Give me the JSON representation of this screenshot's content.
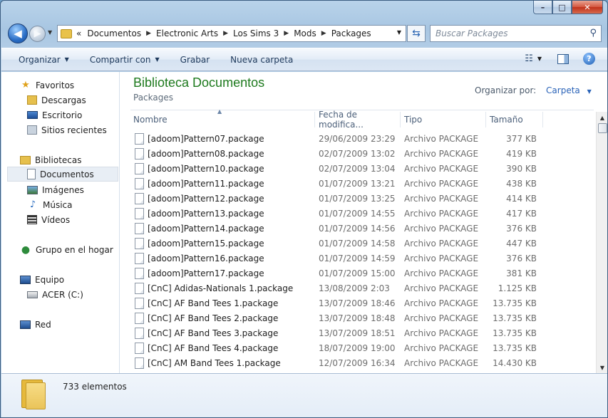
{
  "window": {
    "min_label": "–",
    "max_label": "□",
    "close_label": "✕"
  },
  "nav": {
    "back_label": "◀",
    "fwd_label": "▶",
    "chevrons": "«",
    "breadcrumb": [
      "Documentos",
      "Electronic Arts",
      "Los Sims 3",
      "Mods",
      "Packages"
    ],
    "search_placeholder": "Buscar Packages"
  },
  "toolbar": {
    "organize": "Organizar",
    "share": "Compartir con",
    "burn": "Grabar",
    "new_folder": "Nueva carpeta"
  },
  "sidebar": {
    "favorites": "Favoritos",
    "downloads": "Descargas",
    "desktop": "Escritorio",
    "recent": "Sitios recientes",
    "libraries": "Bibliotecas",
    "documents": "Documentos",
    "images": "Imágenes",
    "music": "Música",
    "videos": "Vídeos",
    "homegroup": "Grupo en el hogar",
    "computer": "Equipo",
    "drive": "ACER (C:)",
    "network": "Red"
  },
  "content": {
    "library_title": "Biblioteca Documentos",
    "library_subtitle": "Packages",
    "arrange_label": "Organizar por:",
    "arrange_value": "Carpeta",
    "columns": {
      "name": "Nombre",
      "date": "Fecha de modifica...",
      "type": "Tipo",
      "size": "Tamaño"
    },
    "files": [
      {
        "name": "[adoom]Pattern07.package",
        "date": "29/06/2009 23:29",
        "type": "Archivo PACKAGE",
        "size": "377 KB"
      },
      {
        "name": "[adoom]Pattern08.package",
        "date": "02/07/2009 13:02",
        "type": "Archivo PACKAGE",
        "size": "419 KB"
      },
      {
        "name": "[adoom]Pattern10.package",
        "date": "02/07/2009 13:04",
        "type": "Archivo PACKAGE",
        "size": "390 KB"
      },
      {
        "name": "[adoom]Pattern11.package",
        "date": "01/07/2009 13:21",
        "type": "Archivo PACKAGE",
        "size": "438 KB"
      },
      {
        "name": "[adoom]Pattern12.package",
        "date": "01/07/2009 13:25",
        "type": "Archivo PACKAGE",
        "size": "414 KB"
      },
      {
        "name": "[adoom]Pattern13.package",
        "date": "01/07/2009 14:55",
        "type": "Archivo PACKAGE",
        "size": "417 KB"
      },
      {
        "name": "[adoom]Pattern14.package",
        "date": "01/07/2009 14:56",
        "type": "Archivo PACKAGE",
        "size": "376 KB"
      },
      {
        "name": "[adoom]Pattern15.package",
        "date": "01/07/2009 14:58",
        "type": "Archivo PACKAGE",
        "size": "447 KB"
      },
      {
        "name": "[adoom]Pattern16.package",
        "date": "01/07/2009 14:59",
        "type": "Archivo PACKAGE",
        "size": "376 KB"
      },
      {
        "name": "[adoom]Pattern17.package",
        "date": "01/07/2009 15:00",
        "type": "Archivo PACKAGE",
        "size": "381 KB"
      },
      {
        "name": "[CnC] Adidas-Nationals 1.package",
        "date": "13/08/2009 2:03",
        "type": "Archivo PACKAGE",
        "size": "1.125 KB"
      },
      {
        "name": "[CnC] AF Band Tees 1.package",
        "date": "13/07/2009 18:46",
        "type": "Archivo PACKAGE",
        "size": "13.735 KB"
      },
      {
        "name": "[CnC] AF Band Tees 2.package",
        "date": "13/07/2009 18:48",
        "type": "Archivo PACKAGE",
        "size": "13.735 KB"
      },
      {
        "name": "[CnC] AF Band Tees 3.package",
        "date": "13/07/2009 18:51",
        "type": "Archivo PACKAGE",
        "size": "13.735 KB"
      },
      {
        "name": "[CnC] AF Band Tees 4.package",
        "date": "18/07/2009 19:00",
        "type": "Archivo PACKAGE",
        "size": "13.735 KB"
      },
      {
        "name": "[CnC] AM Band Tees 1.package",
        "date": "12/07/2009 16:34",
        "type": "Archivo PACKAGE",
        "size": "14.430 KB"
      }
    ]
  },
  "status": {
    "count": "733 elementos"
  },
  "colors": {
    "library_title": "#1e7a1e",
    "link": "#2a63b8",
    "frame": "#b3cde6"
  }
}
